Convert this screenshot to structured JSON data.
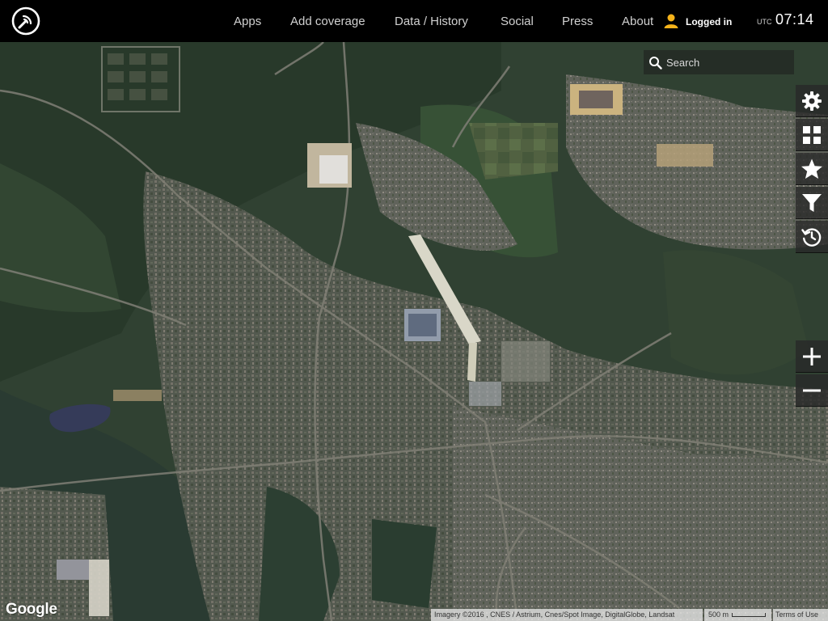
{
  "nav": {
    "items": [
      {
        "label": "Apps"
      },
      {
        "label": "Add coverage"
      },
      {
        "label": "Data / History"
      },
      {
        "label": "Social"
      },
      {
        "label": "Press"
      },
      {
        "label": "About"
      }
    ],
    "user_status": "Logged in",
    "utc_label": "UTC",
    "utc_time": "07:14",
    "icons": {
      "logo": "signal-logo-icon",
      "user": "user-icon"
    },
    "colors": {
      "bar_background": "#000000",
      "user_icon": "#f5b31a"
    }
  },
  "search": {
    "placeholder": "Search",
    "value": ""
  },
  "tools": [
    {
      "icon": "gear-icon"
    },
    {
      "icon": "grid-icon"
    },
    {
      "icon": "star-icon"
    },
    {
      "icon": "filter-icon"
    },
    {
      "icon": "history-icon"
    }
  ],
  "zoom": {
    "in_icon": "plus-icon",
    "out_icon": "minus-icon"
  },
  "footer": {
    "google_logo": "Google",
    "attribution": "Imagery ©2016 , CNES / Astrium, Cnes/Spot Image, DigitalGlobe, Landsat",
    "scale": "500 m",
    "terms": "Terms of Use"
  }
}
